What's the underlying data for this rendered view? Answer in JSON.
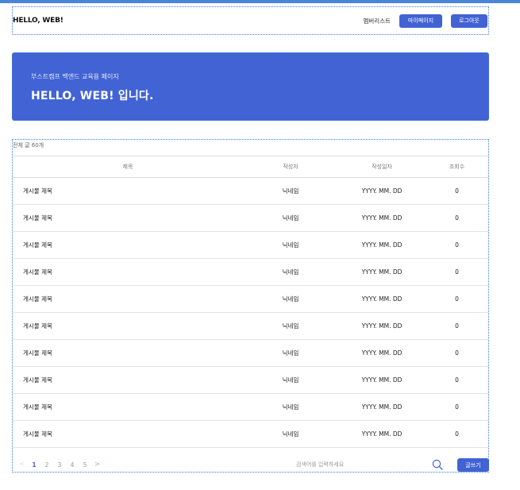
{
  "header": {
    "logo": "HELLO, WEB!",
    "member_link": "멤버리스트",
    "mypage_label": "마이페이지",
    "logout_label": "로그아웃"
  },
  "hero": {
    "subtitle": "부스트캠프 백엔드 교육용 페이지",
    "title": "HELLO, WEB! 입니다."
  },
  "board": {
    "total_text": "전체 글 60개",
    "columns": {
      "title": "제목",
      "author": "작성자",
      "date": "작성일자",
      "views": "조회수"
    },
    "rows": [
      {
        "title": "게시물 제목",
        "author": "닉네임",
        "date": "YYYY. MM. DD",
        "views": "0"
      },
      {
        "title": "게시물 제목",
        "author": "닉네임",
        "date": "YYYY. MM. DD",
        "views": "0"
      },
      {
        "title": "게시물 제목",
        "author": "닉네임",
        "date": "YYYY. MM. DD",
        "views": "0"
      },
      {
        "title": "게시물 제목",
        "author": "닉네임",
        "date": "YYYY. MM. DD",
        "views": "0"
      },
      {
        "title": "게시물 제목",
        "author": "닉네임",
        "date": "YYYY. MM. DD",
        "views": "0"
      },
      {
        "title": "게시물 제목",
        "author": "닉네임",
        "date": "YYYY. MM. DD",
        "views": "0"
      },
      {
        "title": "게시물 제목",
        "author": "닉네임",
        "date": "YYYY. MM. DD",
        "views": "0"
      },
      {
        "title": "게시물 제목",
        "author": "닉네임",
        "date": "YYYY. MM. DD",
        "views": "0"
      },
      {
        "title": "게시물 제목",
        "author": "닉네임",
        "date": "YYYY. MM. DD",
        "views": "0"
      },
      {
        "title": "게시물 제목",
        "author": "닉네임",
        "date": "YYYY. MM. DD",
        "views": "0"
      }
    ]
  },
  "pagination": {
    "prev": "<",
    "next": ">",
    "pages": [
      "1",
      "2",
      "3",
      "4",
      "5"
    ],
    "current_page": "1"
  },
  "search": {
    "placeholder": "검색어를 입력하세요",
    "icon": "search-icon"
  },
  "write_label": "글쓰기",
  "colors": {
    "accent": "#4263d4",
    "top_bar": "#4a86d8",
    "page_active": "#4263d4",
    "pager_arrow": "#9db3f0"
  }
}
